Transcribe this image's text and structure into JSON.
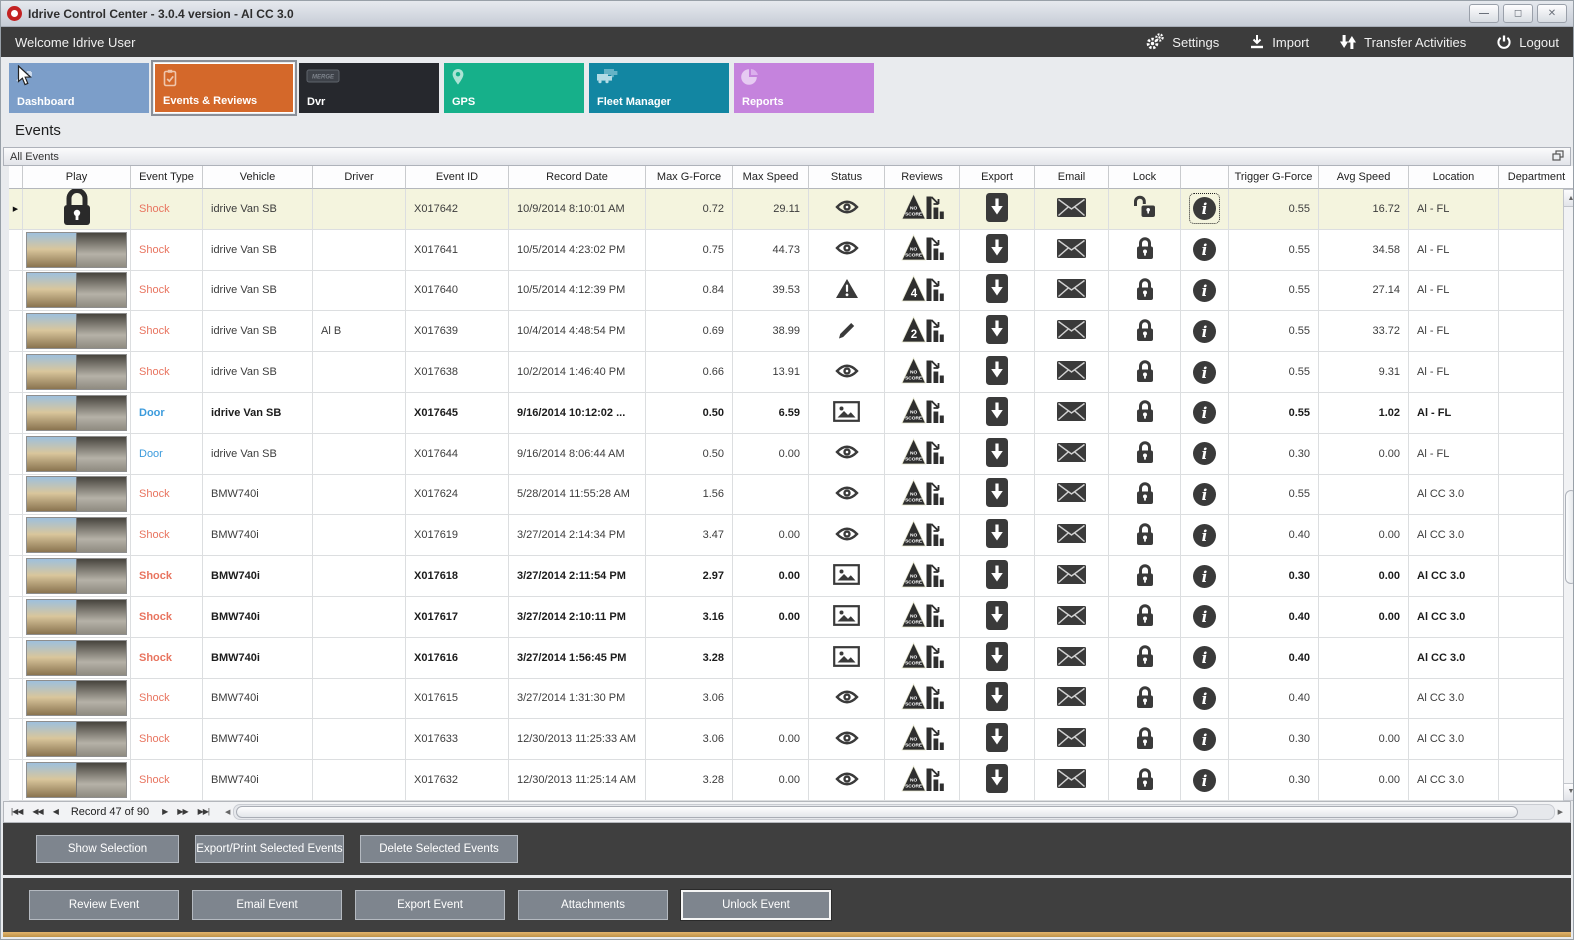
{
  "window": {
    "title": "Idrive Control Center - 3.0.4 version - Al CC 3.0",
    "controls": [
      "minimize",
      "maximize",
      "close"
    ]
  },
  "topbar": {
    "welcome": "Welcome Idrive User",
    "actions": [
      {
        "icon": "gears-icon",
        "label": "Settings"
      },
      {
        "icon": "import-icon",
        "label": "Import"
      },
      {
        "icon": "transfer-icon",
        "label": "Transfer Activities"
      },
      {
        "icon": "power-icon",
        "label": "Logout"
      }
    ]
  },
  "tabs": [
    {
      "label": "Dashboard",
      "color": "#7c9ec9",
      "icon": "dashboard-chart-icon",
      "selected": false
    },
    {
      "label": "Events & Reviews",
      "color": "#d4682a",
      "icon": "clipboard-check-icon",
      "selected": true
    },
    {
      "label": "Dvr",
      "color": "#26282d",
      "icon": "dvr-merge-icon",
      "icon_text": "MERGE",
      "selected": false
    },
    {
      "label": "GPS",
      "color": "#16b08a",
      "icon": "map-pin-icon",
      "selected": false
    },
    {
      "label": "Fleet Manager",
      "color": "#1286a2",
      "icon": "trucks-icon",
      "selected": false
    },
    {
      "label": "Reports",
      "color": "#c583dd",
      "icon": "pie-chart-icon",
      "selected": false
    }
  ],
  "page_title": "Events",
  "group_bar": {
    "title": "All Events",
    "icon": "cascade-windows-icon"
  },
  "table": {
    "columns": [
      "",
      "Play",
      "Event Type",
      "Vehicle",
      "Driver",
      "Event ID",
      "Record Date",
      "Max G-Force",
      "Max Speed",
      "Status",
      "Reviews",
      "Export",
      "Email",
      "Lock",
      "",
      "Trigger G-Force",
      "Avg Speed",
      "Location",
      "Department"
    ],
    "rows": [
      {
        "selected": true,
        "bold": false,
        "play": "lock-glyph",
        "event_type": "Shock",
        "type_class": "shock",
        "vehicle": "idrive Van SB",
        "driver": "",
        "event_id": "X017642",
        "record_date": "10/9/2014 8:10:01 AM",
        "max_g": "0.72",
        "max_speed": "29.11",
        "status": "eye-icon",
        "review_badge": "NO SCORE",
        "lock": "unlocked-icon",
        "trigger_g": "0.55",
        "avg_speed": "16.72",
        "location": "Al - FL",
        "department": ""
      },
      {
        "selected": false,
        "bold": false,
        "play": "thumbnail",
        "event_type": "Shock",
        "type_class": "shock",
        "vehicle": "idrive Van SB",
        "driver": "",
        "event_id": "X017641",
        "record_date": "10/5/2014 4:23:02 PM",
        "max_g": "0.75",
        "max_speed": "44.73",
        "status": "eye-icon",
        "review_badge": "NO SCORE",
        "lock": "locked-icon",
        "trigger_g": "0.55",
        "avg_speed": "34.58",
        "location": "Al - FL",
        "department": ""
      },
      {
        "selected": false,
        "bold": false,
        "play": "thumbnail",
        "event_type": "Shock",
        "type_class": "shock",
        "vehicle": "idrive Van SB",
        "driver": "",
        "event_id": "X017640",
        "record_date": "10/5/2014 4:12:39 PM",
        "max_g": "0.84",
        "max_speed": "39.53",
        "status": "warning-icon",
        "review_badge": "4",
        "lock": "locked-icon",
        "trigger_g": "0.55",
        "avg_speed": "27.14",
        "location": "Al - FL",
        "department": ""
      },
      {
        "selected": false,
        "bold": false,
        "play": "thumbnail",
        "event_type": "Shock",
        "type_class": "shock",
        "vehicle": "idrive Van SB",
        "driver": "Al B",
        "event_id": "X017639",
        "record_date": "10/4/2014 4:48:54 PM",
        "max_g": "0.69",
        "max_speed": "38.99",
        "status": "pencil-icon",
        "review_badge": "2",
        "lock": "locked-icon",
        "trigger_g": "0.55",
        "avg_speed": "33.72",
        "location": "Al - FL",
        "department": ""
      },
      {
        "selected": false,
        "bold": false,
        "play": "thumbnail",
        "event_type": "Shock",
        "type_class": "shock",
        "vehicle": "idrive Van SB",
        "driver": "",
        "event_id": "X017638",
        "record_date": "10/2/2014 1:46:40 PM",
        "max_g": "0.66",
        "max_speed": "13.91",
        "status": "eye-icon",
        "review_badge": "NO SCORE",
        "lock": "locked-icon",
        "trigger_g": "0.55",
        "avg_speed": "9.31",
        "location": "Al - FL",
        "department": ""
      },
      {
        "selected": false,
        "bold": true,
        "play": "thumbnail",
        "event_type": "Door",
        "type_class": "door",
        "vehicle": "idrive Van SB",
        "driver": "",
        "event_id": "X017645",
        "record_date": "9/16/2014 10:12:02 ...",
        "max_g": "0.50",
        "max_speed": "6.59",
        "status": "picture-icon",
        "review_badge": "NO SCORE",
        "lock": "locked-icon",
        "trigger_g": "0.55",
        "avg_speed": "1.02",
        "location": "Al - FL",
        "department": ""
      },
      {
        "selected": false,
        "bold": false,
        "play": "thumbnail",
        "event_type": "Door",
        "type_class": "door",
        "vehicle": "idrive Van SB",
        "driver": "",
        "event_id": "X017644",
        "record_date": "9/16/2014 8:06:44 AM",
        "max_g": "0.50",
        "max_speed": "0.00",
        "status": "eye-icon",
        "review_badge": "NO SCORE",
        "lock": "locked-icon",
        "trigger_g": "0.30",
        "avg_speed": "0.00",
        "location": "Al - FL",
        "department": ""
      },
      {
        "selected": false,
        "bold": false,
        "play": "thumbnail",
        "event_type": "Shock",
        "type_class": "shock",
        "vehicle": "BMW740i",
        "driver": "",
        "event_id": "X017624",
        "record_date": "5/28/2014 11:55:28 AM",
        "max_g": "1.56",
        "max_speed": "",
        "status": "eye-icon",
        "review_badge": "NO SCORE",
        "lock": "locked-icon",
        "trigger_g": "0.55",
        "avg_speed": "",
        "location": "Al CC 3.0",
        "department": ""
      },
      {
        "selected": false,
        "bold": false,
        "play": "thumbnail",
        "event_type": "Shock",
        "type_class": "shock",
        "vehicle": "BMW740i",
        "driver": "",
        "event_id": "X017619",
        "record_date": "3/27/2014 2:14:34 PM",
        "max_g": "3.47",
        "max_speed": "0.00",
        "status": "eye-icon",
        "review_badge": "NO SCORE",
        "lock": "locked-icon",
        "trigger_g": "0.40",
        "avg_speed": "0.00",
        "location": "Al CC 3.0",
        "department": ""
      },
      {
        "selected": false,
        "bold": true,
        "play": "thumbnail",
        "event_type": "Shock",
        "type_class": "shock",
        "vehicle": "BMW740i",
        "driver": "",
        "event_id": "X017618",
        "record_date": "3/27/2014 2:11:54 PM",
        "max_g": "2.97",
        "max_speed": "0.00",
        "status": "picture-icon",
        "review_badge": "NO SCORE",
        "lock": "locked-icon",
        "trigger_g": "0.30",
        "avg_speed": "0.00",
        "location": "Al CC 3.0",
        "department": ""
      },
      {
        "selected": false,
        "bold": true,
        "play": "thumbnail",
        "event_type": "Shock",
        "type_class": "shock",
        "vehicle": "BMW740i",
        "driver": "",
        "event_id": "X017617",
        "record_date": "3/27/2014 2:10:11 PM",
        "max_g": "3.16",
        "max_speed": "0.00",
        "status": "picture-icon",
        "review_badge": "NO SCORE",
        "lock": "locked-icon",
        "trigger_g": "0.40",
        "avg_speed": "0.00",
        "location": "Al CC 3.0",
        "department": ""
      },
      {
        "selected": false,
        "bold": true,
        "play": "thumbnail",
        "event_type": "Shock",
        "type_class": "shock",
        "vehicle": "BMW740i",
        "driver": "",
        "event_id": "X017616",
        "record_date": "3/27/2014 1:56:45 PM",
        "max_g": "3.28",
        "max_speed": "",
        "status": "picture-icon",
        "review_badge": "NO SCORE",
        "lock": "locked-icon",
        "trigger_g": "0.40",
        "avg_speed": "",
        "location": "Al CC 3.0",
        "department": ""
      },
      {
        "selected": false,
        "bold": false,
        "play": "thumbnail",
        "event_type": "Shock",
        "type_class": "shock",
        "vehicle": "BMW740i",
        "driver": "",
        "event_id": "X017615",
        "record_date": "3/27/2014 1:31:30 PM",
        "max_g": "3.06",
        "max_speed": "",
        "status": "eye-icon",
        "review_badge": "NO SCORE",
        "lock": "locked-icon",
        "trigger_g": "0.40",
        "avg_speed": "",
        "location": "Al CC 3.0",
        "department": ""
      },
      {
        "selected": false,
        "bold": false,
        "play": "thumbnail",
        "event_type": "Shock",
        "type_class": "shock",
        "vehicle": "BMW740i",
        "driver": "",
        "event_id": "X017633",
        "record_date": "12/30/2013 11:25:33 AM",
        "max_g": "3.06",
        "max_speed": "0.00",
        "status": "eye-icon",
        "review_badge": "NO SCORE",
        "lock": "locked-icon",
        "trigger_g": "0.30",
        "avg_speed": "0.00",
        "location": "Al CC 3.0",
        "department": ""
      },
      {
        "selected": false,
        "bold": false,
        "play": "thumbnail",
        "event_type": "Shock",
        "type_class": "shock",
        "vehicle": "BMW740i",
        "driver": "",
        "event_id": "X017632",
        "record_date": "12/30/2013 11:25:14 AM",
        "max_g": "3.28",
        "max_speed": "0.00",
        "status": "eye-icon",
        "review_badge": "NO SCORE",
        "lock": "locked-icon",
        "trigger_g": "0.30",
        "avg_speed": "0.00",
        "location": "Al CC 3.0",
        "department": ""
      }
    ]
  },
  "navigator": {
    "vcr_left": [
      "|◀◀",
      "◀◀",
      "◀"
    ],
    "record_text": "Record 47 of 90",
    "vcr_right": [
      "▶",
      "▶▶",
      "▶▶|"
    ]
  },
  "selection_buttons": [
    "Show Selection",
    "Export/Print Selected Events",
    "Delete Selected  Events"
  ],
  "event_buttons": [
    "Review Event",
    "Email Event",
    "Export Event",
    "Attachments",
    "Unlock Event"
  ],
  "colors": {
    "shock_text": "#e8745f",
    "door_text": "#3c9bdc",
    "selected_row": "#f4f4de",
    "accent_orange": "#d4682a",
    "icon_dark": "#3a3a3a"
  }
}
